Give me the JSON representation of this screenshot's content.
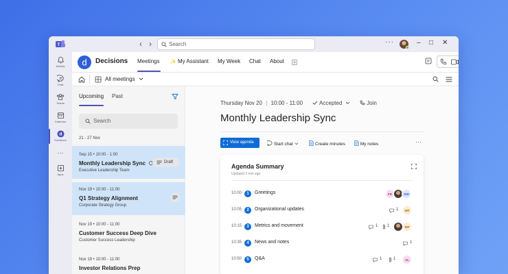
{
  "titlebar": {
    "search_placeholder": "Search",
    "more": "···",
    "minimize": "–",
    "maximize": "□",
    "close": "✕"
  },
  "rail": {
    "items": [
      {
        "label": "Activity"
      },
      {
        "label": "Chat"
      },
      {
        "label": "Teams"
      },
      {
        "label": "Calendar"
      },
      {
        "label": "Decisions"
      },
      {
        "label": "···"
      },
      {
        "label": "Apps"
      }
    ]
  },
  "app": {
    "title": "Decisions",
    "logo_letter": "d",
    "tabs": [
      {
        "label": "Meetings"
      },
      {
        "label": "My Assistant"
      },
      {
        "label": "My Week"
      },
      {
        "label": "Chat"
      },
      {
        "label": "About"
      }
    ]
  },
  "subbar": {
    "filter_label": "All meetings"
  },
  "list": {
    "tabs": [
      {
        "label": "Upcoming"
      },
      {
        "label": "Past"
      }
    ],
    "search_placeholder": "Search",
    "range": "21 - 27 Nov",
    "meetings": [
      {
        "when": "Sep 15  •  10:00 - 1:00",
        "title": "Monthly Leadership Sync",
        "team": "Executive Leadership Team",
        "badge": "Draft"
      },
      {
        "when": "Nov 19  •  10:00 - 11:00",
        "title": "Q1 Strategy Alignment",
        "team": "Corporate Strategy Group"
      },
      {
        "when": "Nov 19  •  10:00 - 11:00",
        "title": "Customer Success Deep Dive",
        "team": "Customer Success Leadership"
      },
      {
        "when": "Nov 19  •  10:00 - 11:00",
        "title": "Investor Relations Prep",
        "team": ""
      }
    ]
  },
  "detail": {
    "date": "Thursday Nov 20",
    "sep": "|",
    "time": "10:00 - 11:00",
    "status": "Accepted",
    "join": "Join",
    "title": "Monthly Leadership Sync",
    "actions": {
      "view_agenda": "View agenda",
      "start_chat": "Start chat",
      "create_minutes": "Create minutes",
      "my_notes": "My notes",
      "more": "···"
    },
    "card": {
      "title": "Agenda Summary",
      "updated": "Updated 2 min ago",
      "items": [
        {
          "time": "10:00",
          "num": "1",
          "label": "Greetings"
        },
        {
          "time": "10:05",
          "num": "2",
          "label": "Organizational updates",
          "comments": "1"
        },
        {
          "time": "10:15",
          "num": "3",
          "label": "Metrics and movement",
          "comments": "1",
          "attachments": "1"
        },
        {
          "time": "10:35",
          "num": "4",
          "label": "News and notes",
          "comments": "1"
        },
        {
          "time": "10:50",
          "num": "5",
          "label": "Q&A",
          "comments": "1",
          "attachments": "1"
        }
      ],
      "avatars": {
        "fr": "FR",
        "dw": "DW",
        "wf": "WF",
        "al": "AL"
      }
    }
  },
  "colors": {
    "accent": "#4f52b2",
    "primary_button": "#0f6cd6",
    "selected_row": "#cfe4f8"
  }
}
